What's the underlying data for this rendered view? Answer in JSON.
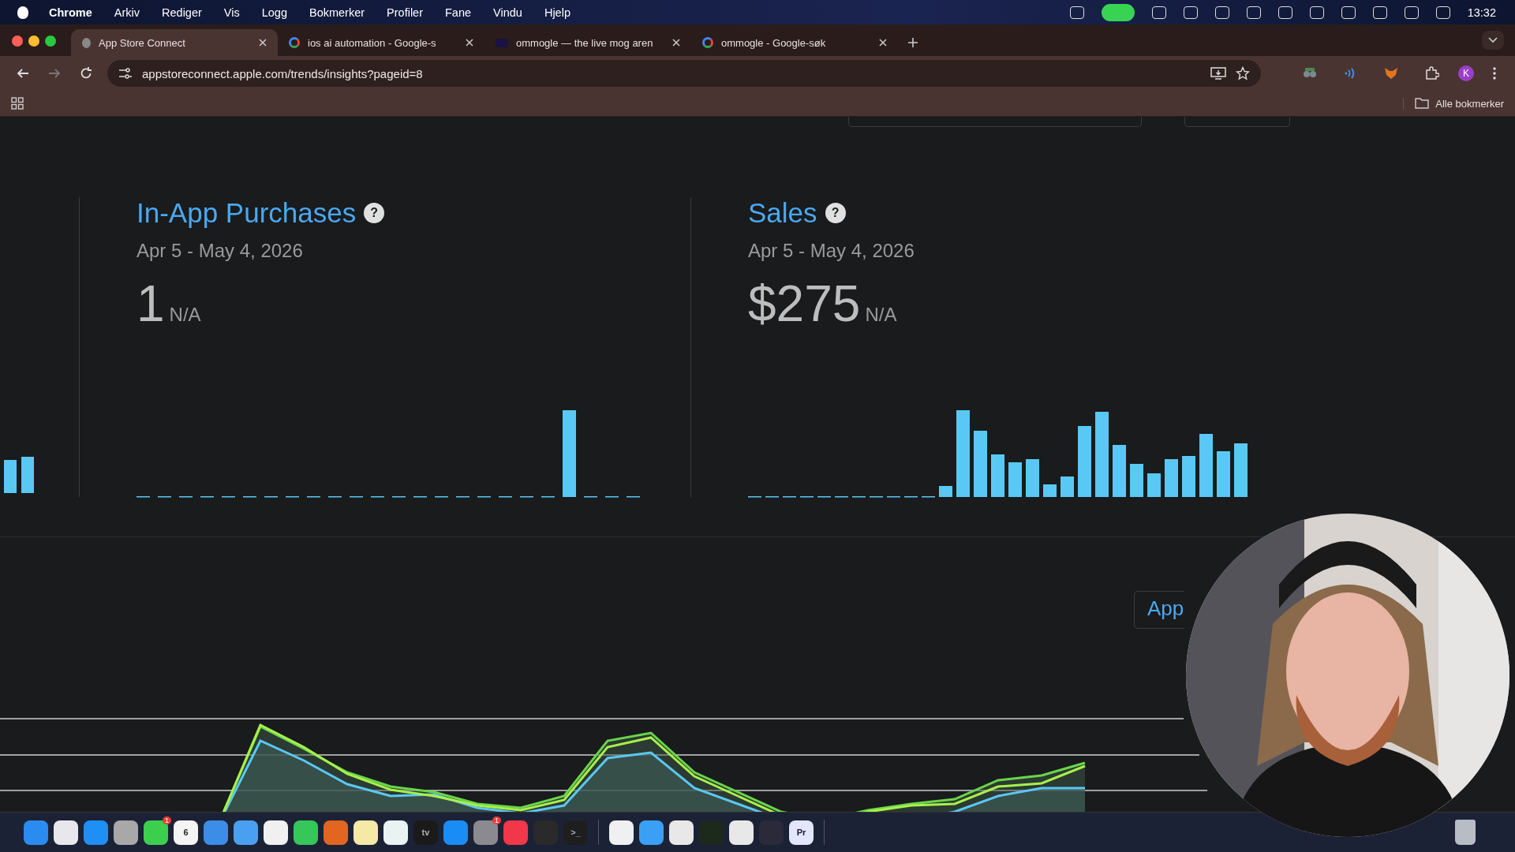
{
  "menu_bar": {
    "app": "Chrome",
    "items": [
      "Arkiv",
      "Rediger",
      "Vis",
      "Logg",
      "Bokmerker",
      "Profiler",
      "Fane",
      "Vindu",
      "Hjelp"
    ],
    "clock": "13:32"
  },
  "tabs": [
    {
      "title": "App Store Connect",
      "selected": true
    },
    {
      "title": "ios ai automation - Google-s",
      "selected": false
    },
    {
      "title": "ommogle — the live mog aren",
      "selected": false
    },
    {
      "title": "ommogle - Google-søk",
      "selected": false
    }
  ],
  "address_bar": {
    "value": "appstoreconnect.apple.com/trends/insights?pageid=8"
  },
  "profile_initial": "K",
  "bookmarks": {
    "all_label": "Alle bokmerker"
  },
  "panels": [
    {
      "title": "In-App Purchases",
      "help": "?",
      "period": "Apr 5 - May 4, 2026",
      "value": "1",
      "change": "N/A"
    },
    {
      "title": "Sales",
      "help": "?",
      "period": "Apr 5 - May 4, 2026",
      "value": "$275",
      "change": "N/A"
    }
  ],
  "app_button": {
    "label": "App"
  },
  "dock": [
    {
      "color": "#2a8cf0"
    },
    {
      "color": "#e8e8ec"
    },
    {
      "color": "#1e8ff5"
    },
    {
      "color": "#a8a8a8"
    },
    {
      "color": "#3ccf4e",
      "badge": "1"
    },
    {
      "color": "#f4f4f4",
      "label": "6"
    },
    {
      "color": "#3b8de8"
    },
    {
      "color": "#4aa0f0"
    },
    {
      "color": "#f0f0f0"
    },
    {
      "color": "#35c759"
    },
    {
      "color": "#e2661f"
    },
    {
      "color": "#f5e9a6"
    },
    {
      "color": "#e9f4f2"
    },
    {
      "color": "#1a1a1a",
      "label": "tv"
    },
    {
      "color": "#1a8cf5"
    },
    {
      "color": "#8a8a90",
      "badge": "1"
    },
    {
      "color": "#f2374a"
    },
    {
      "color": "#2a2a2a"
    },
    {
      "color": "#1e1e1e",
      "label": ">_"
    },
    {
      "color": "#f0f0f0"
    },
    {
      "color": "#3aa0f5"
    },
    {
      "color": "#e8e8e8"
    },
    {
      "color": "#1c2a1c"
    },
    {
      "color": "#e8e8e8"
    },
    {
      "color": "#2a2a3a"
    },
    {
      "color": "#e3e6ff",
      "label": "Pr"
    }
  ]
}
